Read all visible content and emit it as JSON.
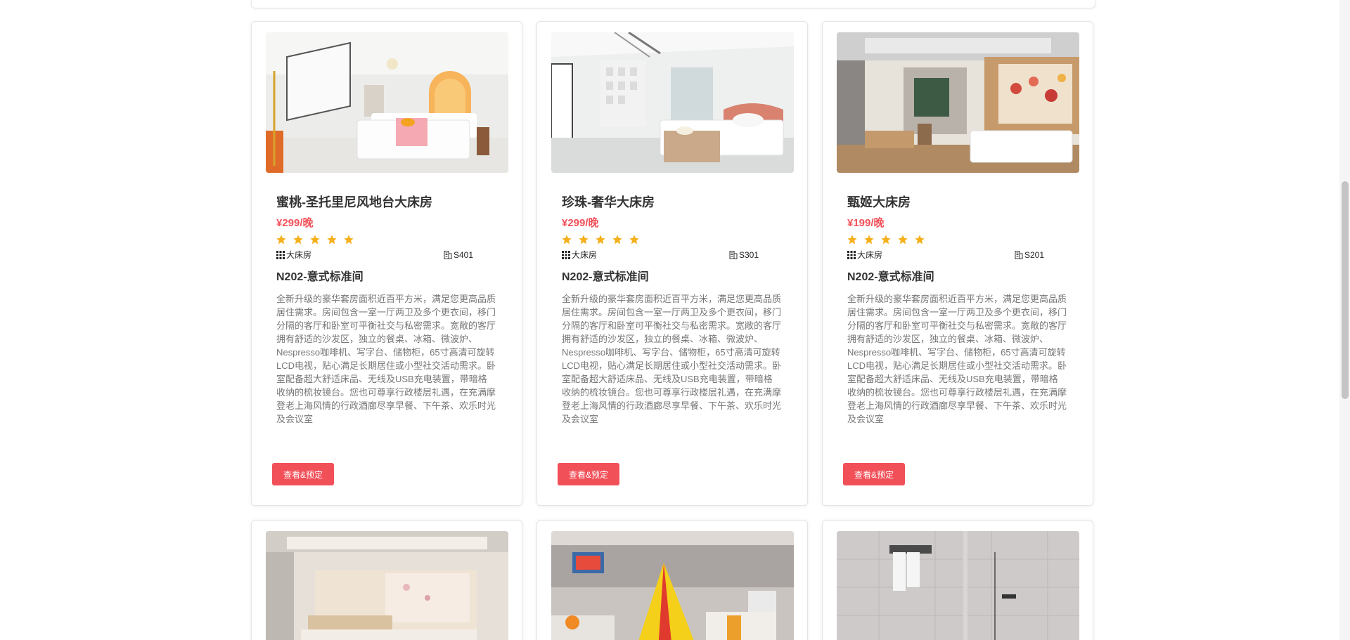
{
  "colors": {
    "accent": "#f25059",
    "star": "#f5b01c",
    "text": "#333333",
    "muted": "#777777"
  },
  "icons": {
    "star": "star-icon",
    "room_type": "grid-icon",
    "room_number": "building-icon"
  },
  "rooms": [
    {
      "name": "蜜桃-圣托里尼风地台大床房",
      "price": "¥299/晚",
      "rating": 5,
      "type": "大床房",
      "number": "S401",
      "subtitle": "N202-意式标准间",
      "description": "全新升级的豪华套房面积近百平方米，满足您更高品质居住需求。房间包含一室一厅两卫及多个更衣间，移门分隔的客厅和卧室可平衡社交与私密需求。宽敞的客厅拥有舒适的沙发区，独立的餐桌、冰箱、微波炉、Nespresso咖啡机、写字台、储物柜，65寸高清可旋转LCD电视，贴心满足长期居住或小型社交活动需求。卧室配备超大舒适床品、无线及USB充电装置，带暗格收纳的梳妆镜台。您也可尊享行政楼层礼遇，在充满摩登老上海风情的行政酒廊尽享早餐、下午茶、欢乐时光及会议室",
      "button": "查看&预定"
    },
    {
      "name": "珍珠-奢华大床房",
      "price": "¥299/晚",
      "rating": 5,
      "type": "大床房",
      "number": "S301",
      "subtitle": "N202-意式标准间",
      "description": "全新升级的豪华套房面积近百平方米，满足您更高品质居住需求。房间包含一室一厅两卫及多个更衣间，移门分隔的客厅和卧室可平衡社交与私密需求。宽敞的客厅拥有舒适的沙发区，独立的餐桌、冰箱、微波炉、Nespresso咖啡机、写字台、储物柜，65寸高清可旋转LCD电视，贴心满足长期居住或小型社交活动需求。卧室配备超大舒适床品、无线及USB充电装置，带暗格收纳的梳妆镜台。您也可尊享行政楼层礼遇，在充满摩登老上海风情的行政酒廊尽享早餐、下午茶、欢乐时光及会议室",
      "button": "查看&预定"
    },
    {
      "name": "甄姬大床房",
      "price": "¥199/晚",
      "rating": 5,
      "type": "大床房",
      "number": "S201",
      "subtitle": "N202-意式标准间",
      "description": "全新升级的豪华套房面积近百平方米，满足您更高品质居住需求。房间包含一室一厅两卫及多个更衣间，移门分隔的客厅和卧室可平衡社交与私密需求。宽敞的客厅拥有舒适的沙发区，独立的餐桌、冰箱、微波炉、Nespresso咖啡机、写字台、储物柜，65寸高清可旋转LCD电视，贴心满足长期居住或小型社交活动需求。卧室配备超大舒适床品、无线及USB充电装置，带暗格收纳的梳妆镜台。您也可尊享行政楼层礼遇，在充满摩登老上海风情的行政酒廊尽享早餐、下午茶、欢乐时光及会议室",
      "button": "查看&预定"
    }
  ]
}
